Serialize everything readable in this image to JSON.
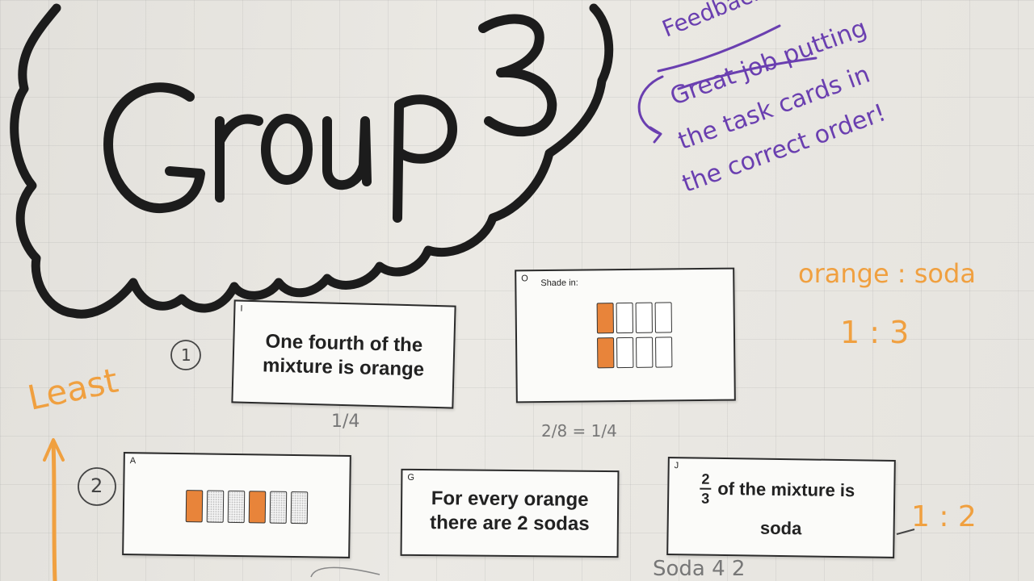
{
  "title": "Group 3",
  "feedback": {
    "heading": "Feedback",
    "lines": [
      "Great job putting",
      "the task cards in",
      "the correct order!"
    ]
  },
  "ratio": {
    "header": "orange : soda",
    "value": "1 : 3",
    "right_note": "1 : 2"
  },
  "order_label": "Least",
  "steps": [
    "1",
    "2"
  ],
  "cards": {
    "I": {
      "letter": "I",
      "text_lines": [
        "One fourth of the",
        "mixture is orange"
      ]
    },
    "O": {
      "letter": "O",
      "label": "Shade in:"
    },
    "A": {
      "letter": "A"
    },
    "G": {
      "letter": "G",
      "text_lines": [
        "For every orange",
        "there are 2 sodas"
      ]
    },
    "J": {
      "letter": "J",
      "num": "2",
      "den": "3",
      "text1": "of the mixture is",
      "text2": "soda"
    }
  },
  "pencil": {
    "under_I": "1/4",
    "under_O": "2/8 = 1/4",
    "bottom": "Soda 4  2"
  },
  "colors": {
    "orange": "#e8843a",
    "purple_marker": "#6a3fb0",
    "black_marker": "#1c1c1c",
    "orange_marker": "#f0a040"
  }
}
